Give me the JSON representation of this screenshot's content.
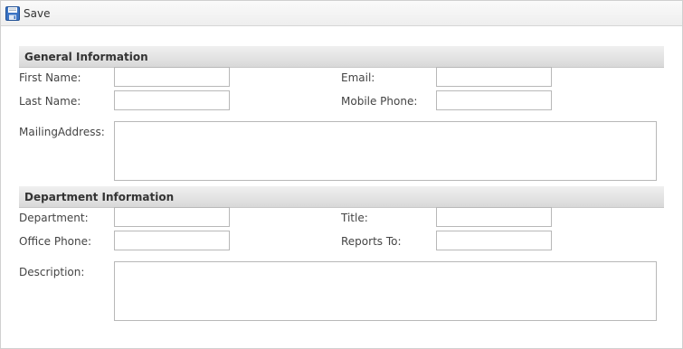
{
  "toolbar": {
    "save_label": "Save",
    "save_icon": "floppy-disk-icon"
  },
  "general": {
    "title": "General Information",
    "first_name_label": "First Name:",
    "last_name_label": "Last Name:",
    "email_label": "Email:",
    "mobile_label": "Mobile Phone:",
    "address_label": "MailingAddress:",
    "first_name_value": "",
    "last_name_value": "",
    "email_value": "",
    "mobile_value": "",
    "address_value": ""
  },
  "department": {
    "title": "Department Information",
    "department_label": "Department:",
    "office_phone_label": "Office Phone:",
    "title_label": "Title:",
    "reports_to_label": "Reports To:",
    "description_label": "Description:",
    "department_value": "",
    "office_phone_value": "",
    "title_value": "",
    "reports_to_value": "",
    "description_value": ""
  }
}
